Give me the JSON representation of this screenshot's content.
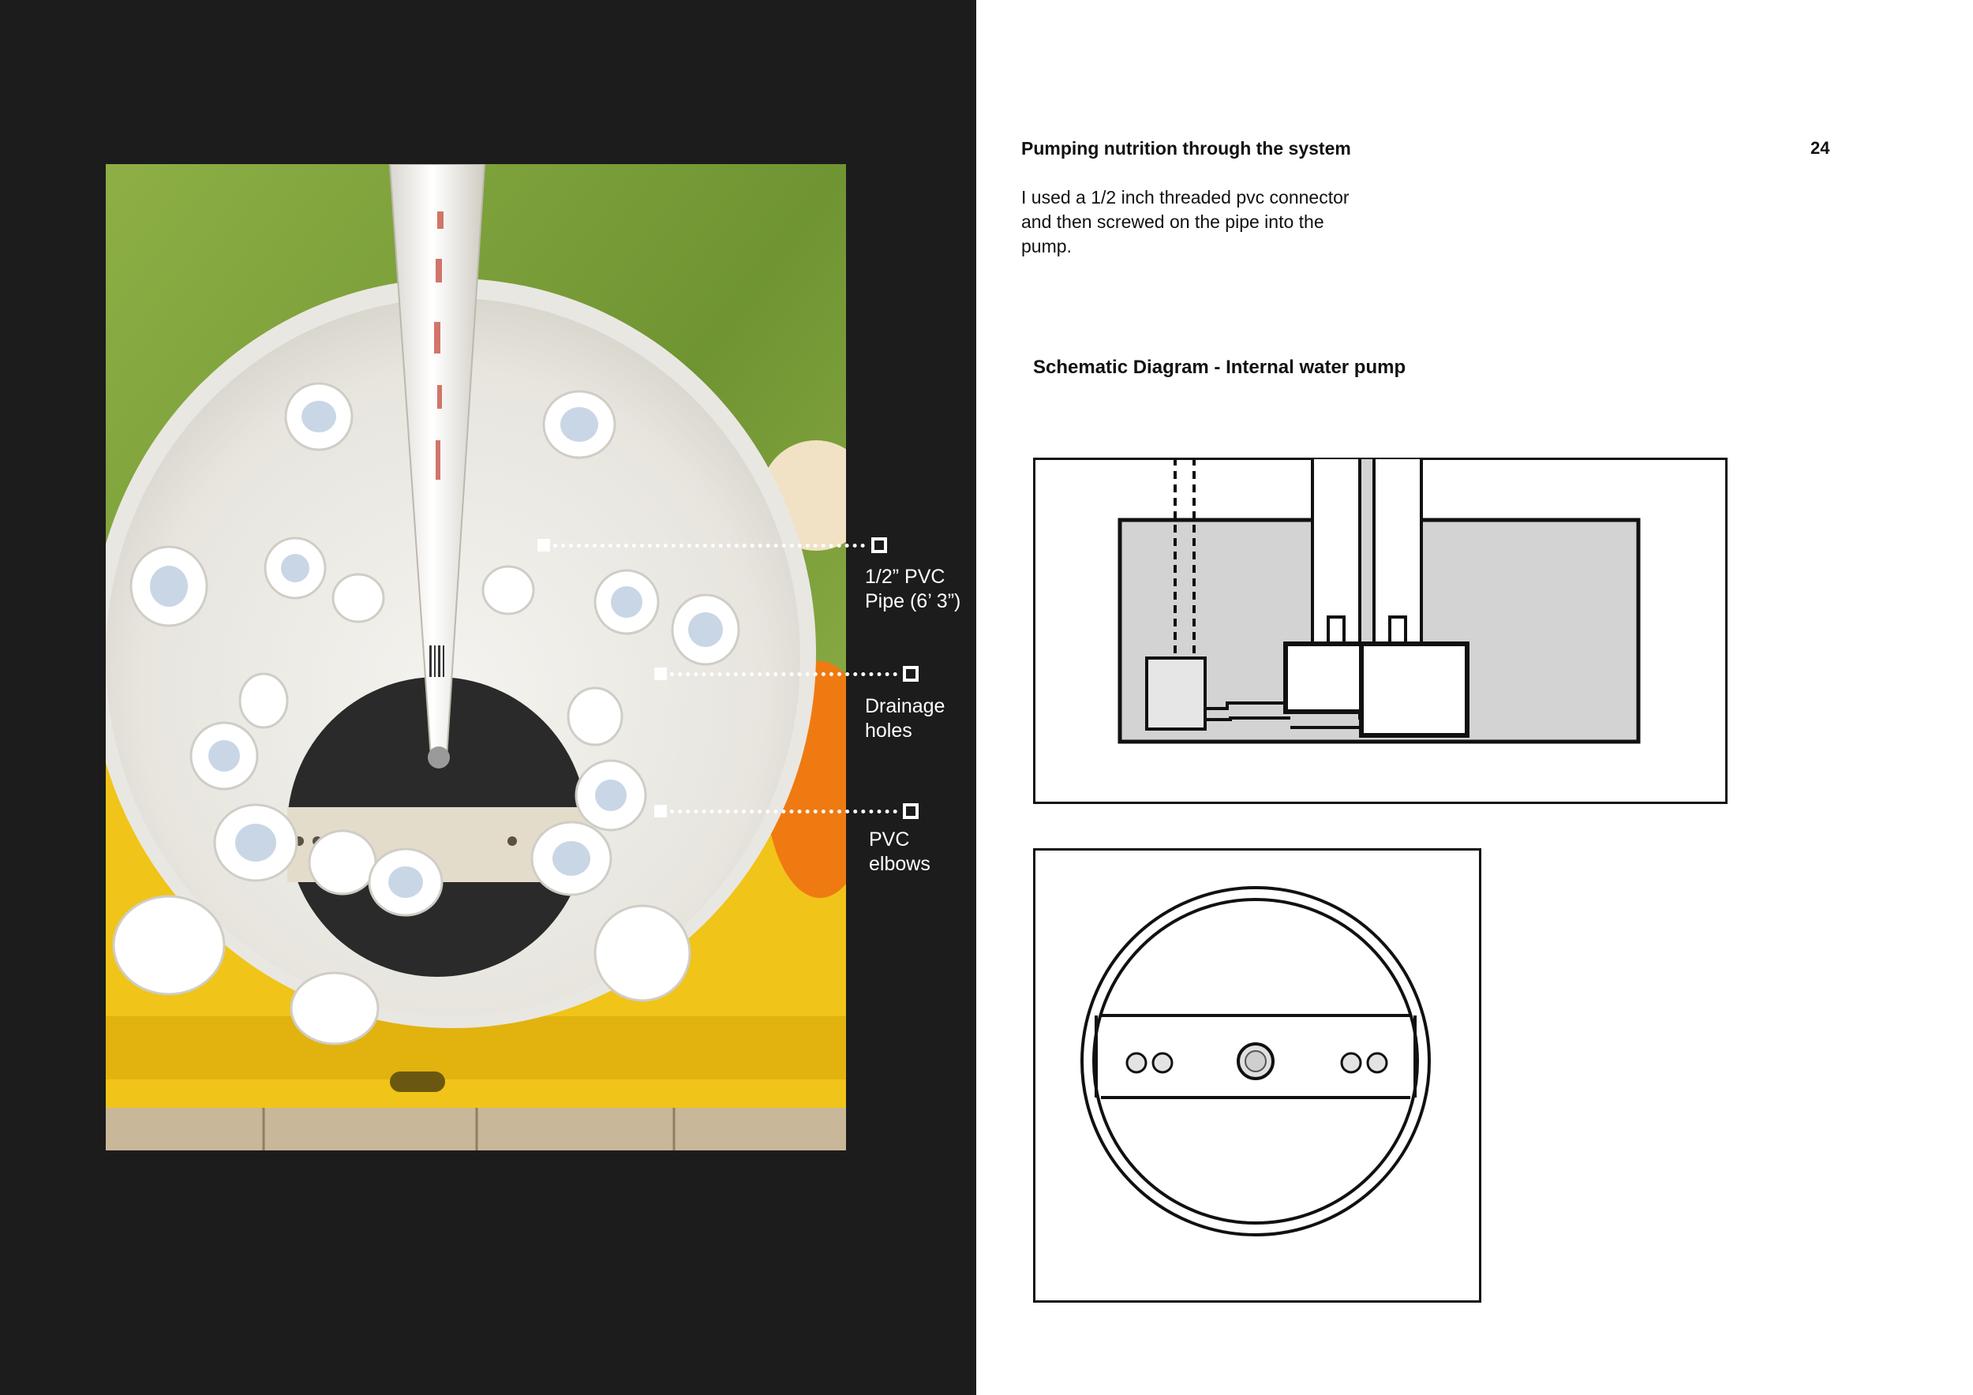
{
  "page": {
    "title": "Pumping nutrition through the system",
    "page_number": "24",
    "body_lines": [
      "I used a 1/2 inch threaded pvc connector",
      "and then screwed on the pipe into the",
      "pump."
    ],
    "schematic_title": "Schematic Diagram - Internal water pump"
  },
  "photo": {
    "annotations": [
      {
        "lines": [
          "1/2” PVC",
          "Pipe (6’ 3”)"
        ]
      },
      {
        "lines": [
          "Drainage",
          "holes"
        ]
      },
      {
        "lines": [
          "PVC",
          "elbows"
        ]
      }
    ]
  },
  "colors": {
    "dark_panel": "#1c1c1c",
    "grass": "#7e9f3a",
    "crate": "#f2c81a",
    "bucket": "#ecebe6",
    "water": "#d3d3d3"
  }
}
